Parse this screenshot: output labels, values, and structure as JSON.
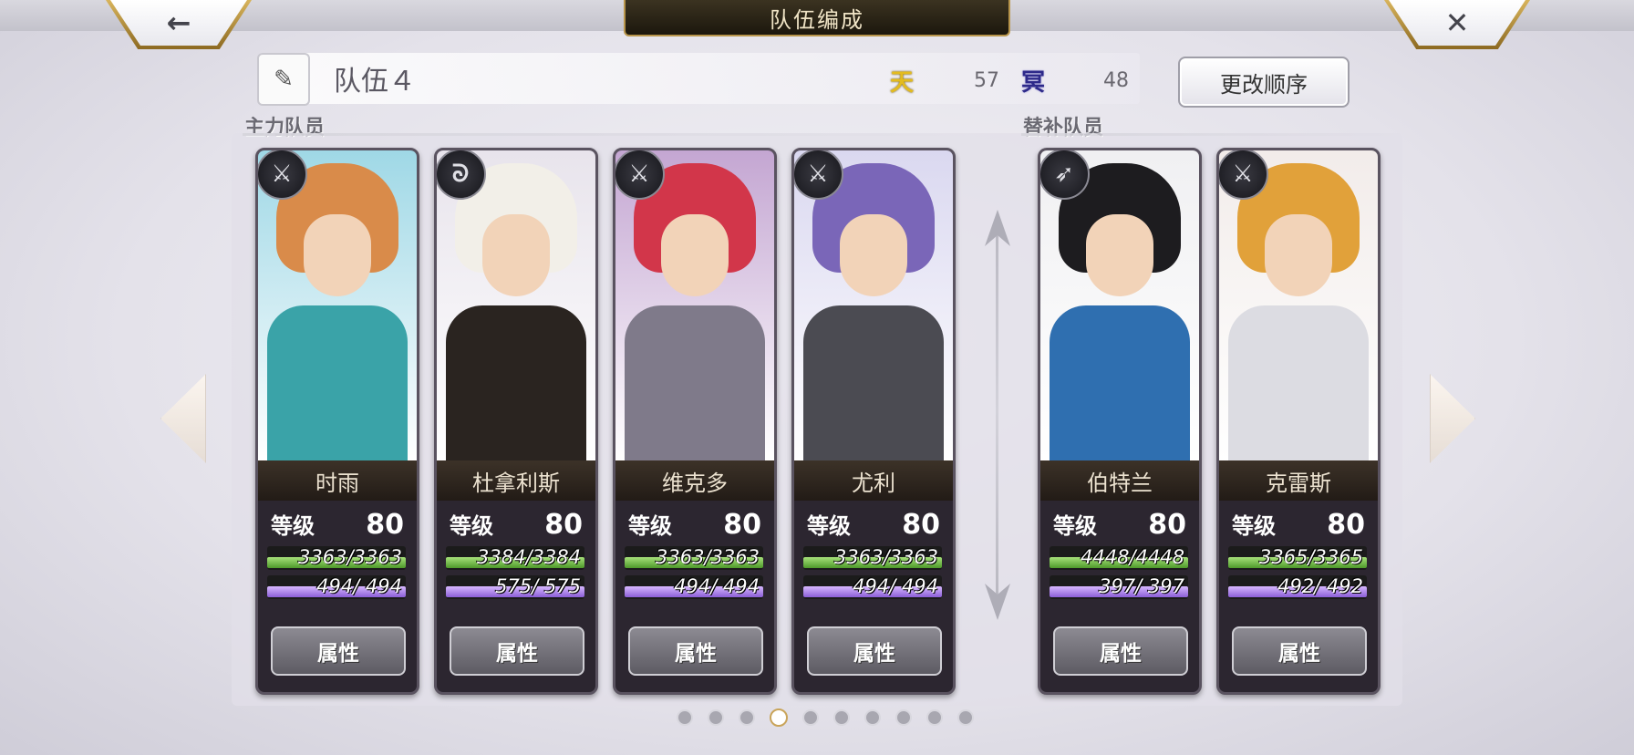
{
  "header": {
    "title": "队伍编成",
    "back_icon": "←",
    "close_icon": "✕"
  },
  "team": {
    "name": "队伍４",
    "sky_icon": "天",
    "sky_value": "57",
    "dark_icon": "冥",
    "dark_value": "48",
    "order_button": "更改顺序",
    "edit_icon": "✎"
  },
  "sections": {
    "main": "主力队员",
    "reserve": "替补队员"
  },
  "labels": {
    "level": "等级",
    "attr_button": "属性"
  },
  "members": [
    {
      "name": "时雨",
      "level": "80",
      "hp": "3363/3363",
      "mp": "494/ 494",
      "weapon_icon": "sword",
      "hair": "#d98b4a",
      "body": "#3aa3a8",
      "bg": "#9fd8e6",
      "hp_fill": 1.0,
      "mp_fill": 1.0
    },
    {
      "name": "杜拿利斯",
      "level": "80",
      "hp": "3384/3384",
      "mp": "575/ 575",
      "weapon_icon": "whip",
      "hair": "#f2efe8",
      "body": "#2a2420",
      "bg": "#e8e4ec",
      "hp_fill": 1.0,
      "mp_fill": 1.0
    },
    {
      "name": "维克多",
      "level": "80",
      "hp": "3363/3363",
      "mp": "494/ 494",
      "weapon_icon": "sword",
      "hair": "#d2364a",
      "body": "#7f7a8a",
      "bg": "#c4a6d2",
      "hp_fill": 1.0,
      "mp_fill": 1.0
    },
    {
      "name": "尤利",
      "level": "80",
      "hp": "3363/3363",
      "mp": "494/ 494",
      "weapon_icon": "sword",
      "hair": "#7a66b8",
      "body": "#4b4b52",
      "bg": "#dad8f0",
      "hp_fill": 1.0,
      "mp_fill": 1.0
    },
    {
      "name": "伯特兰",
      "level": "80",
      "hp": "4448/4448",
      "mp": "397/ 397",
      "weapon_icon": "spear",
      "hair": "#1d1c1f",
      "body": "#2f6fb0",
      "bg": "#f0f0f2",
      "hp_fill": 1.0,
      "mp_fill": 1.0
    },
    {
      "name": "克雷斯",
      "level": "80",
      "hp": "3365/3365",
      "mp": "492/ 492",
      "weapon_icon": "sword",
      "hair": "#e1a13a",
      "body": "#dcdce2",
      "bg": "#f2ecea",
      "hp_fill": 1.0,
      "mp_fill": 1.0
    }
  ],
  "pager": {
    "total": 10,
    "active_index": 3
  }
}
